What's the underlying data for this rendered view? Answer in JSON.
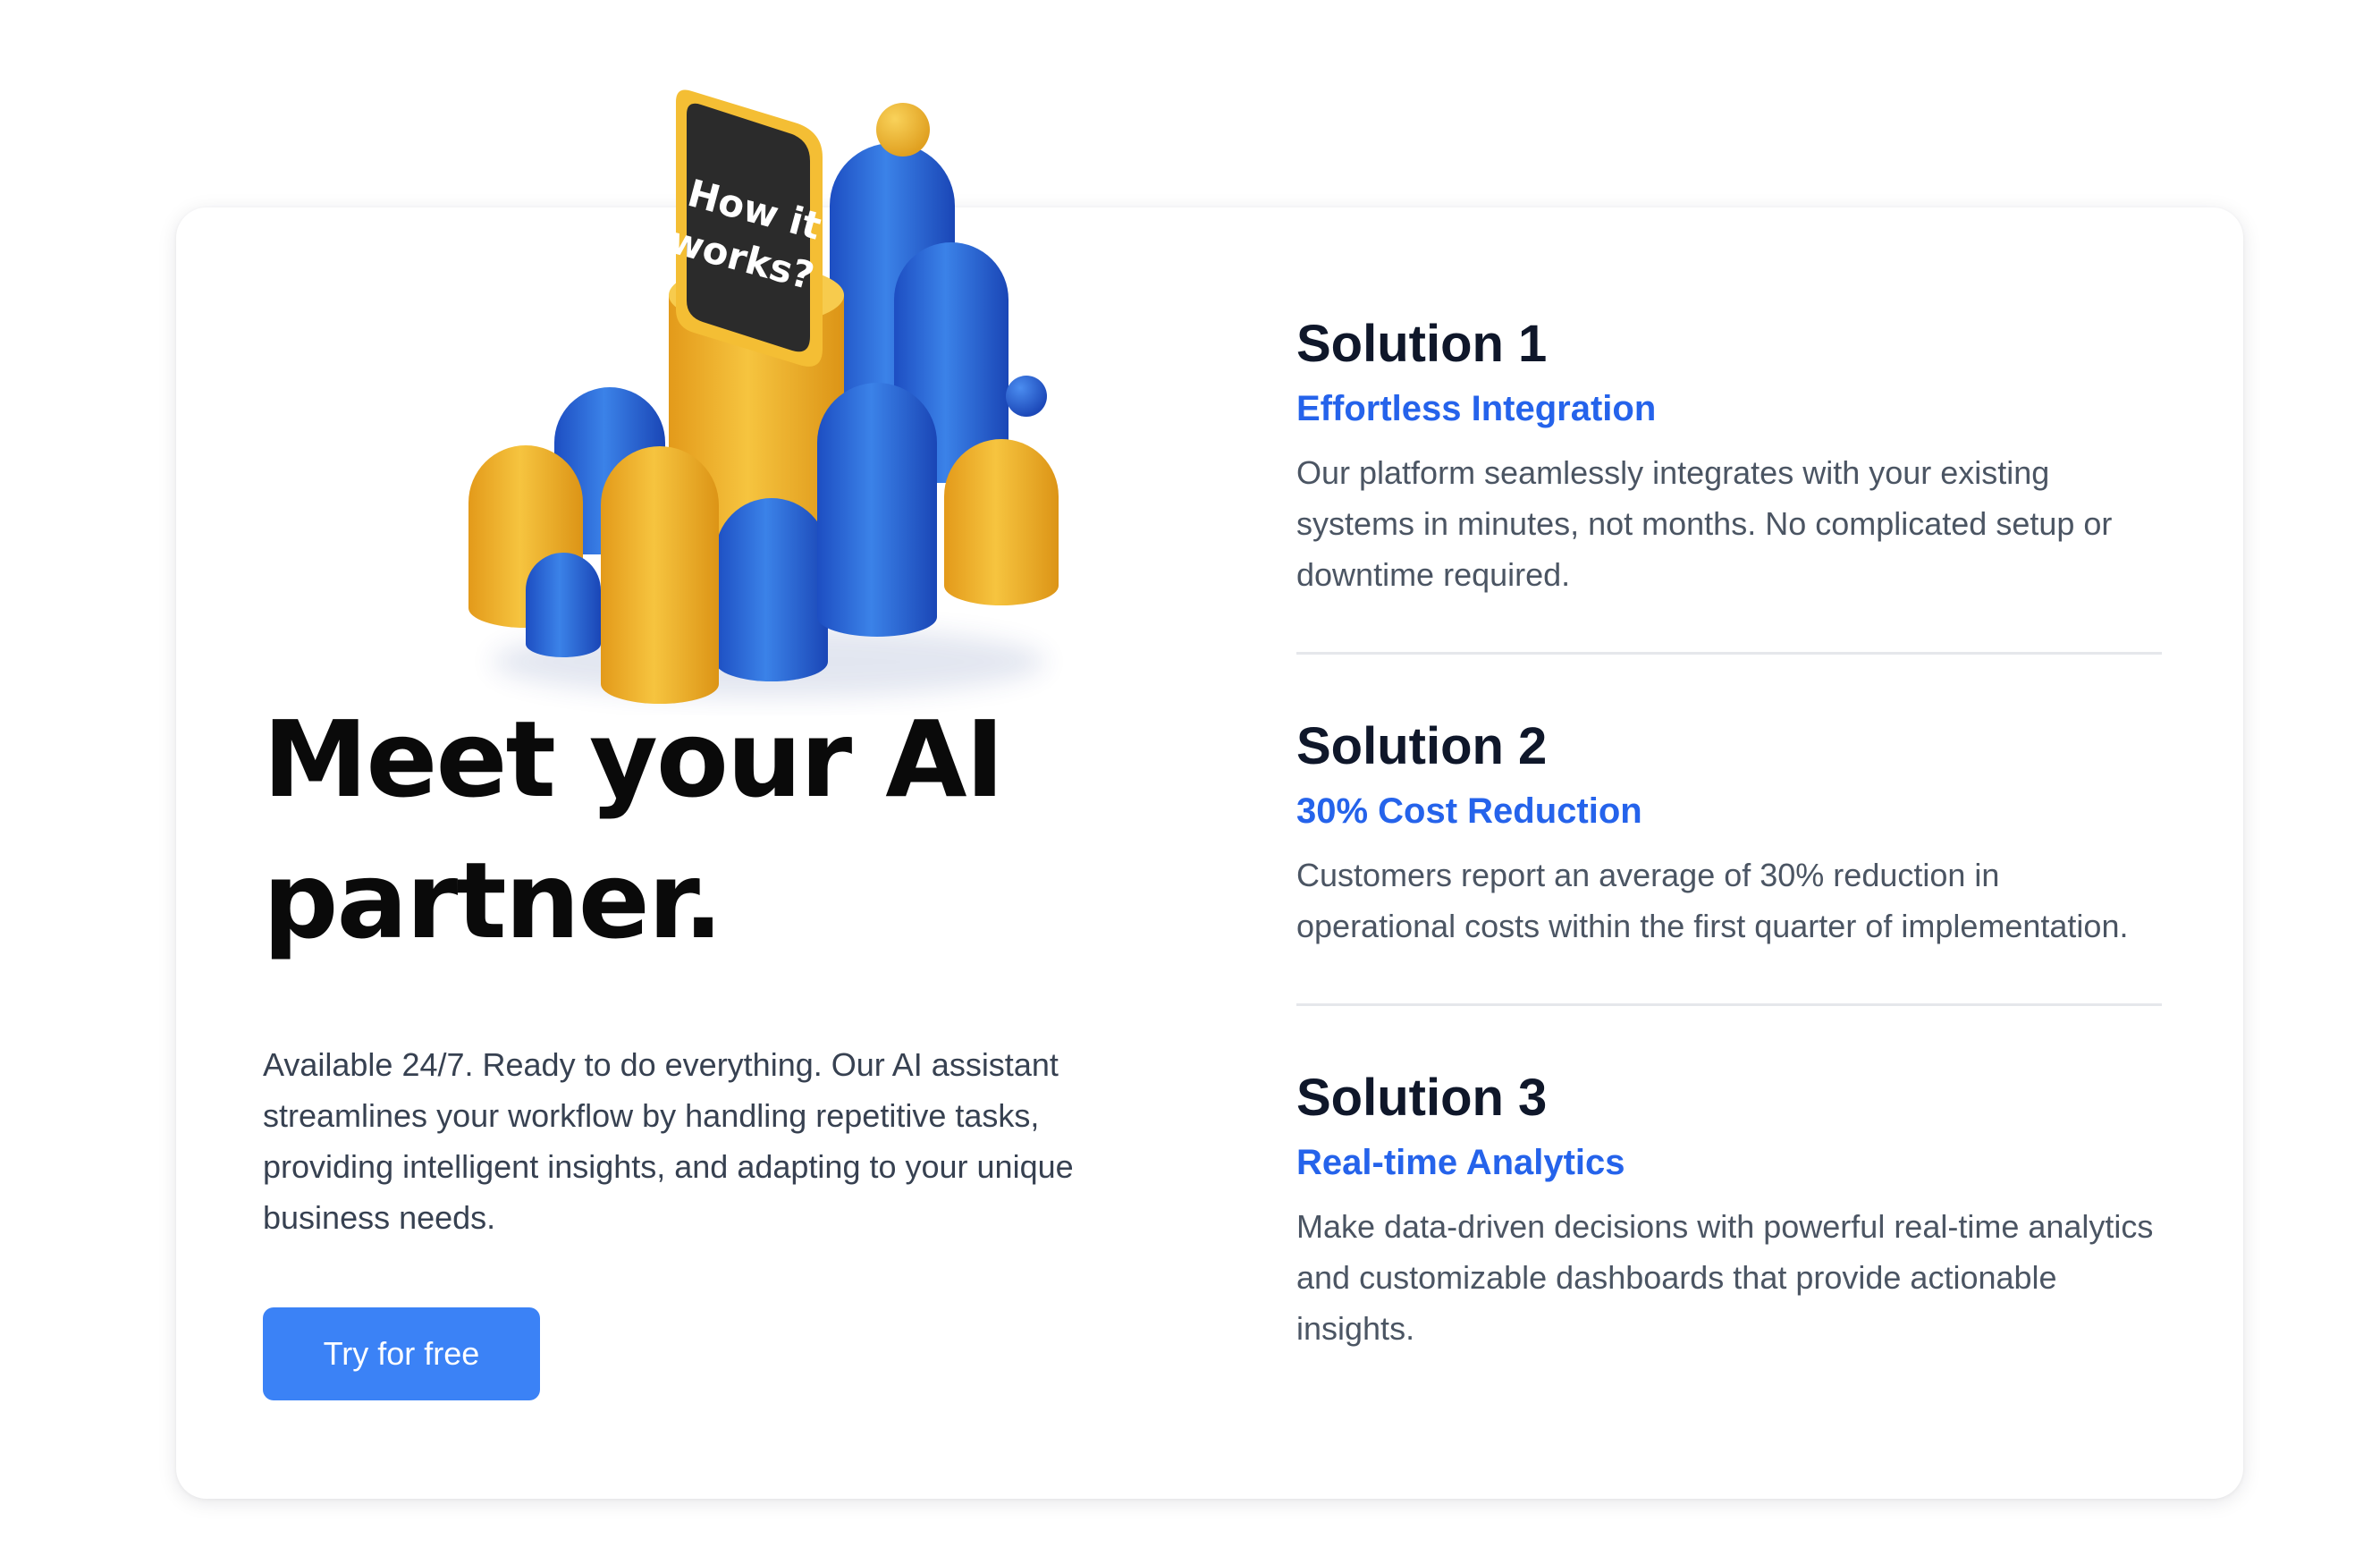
{
  "illustration": {
    "sign_line1": "How it",
    "sign_line2": "works?"
  },
  "hero": {
    "title": "Meet your AI\npartner.",
    "description": "Available 24/7. Ready to do everything. Our AI assistant streamlines your workflow by handling repetitive tasks, providing intelligent insights, and adapting to your unique business needs.",
    "cta_label": "Try for free"
  },
  "solutions": [
    {
      "title": "Solution 1",
      "subtitle": "Effortless Integration",
      "description": "Our platform seamlessly integrates with your existing systems in minutes, not months. No complicated setup or downtime required."
    },
    {
      "title": "Solution 2",
      "subtitle": "30% Cost Reduction",
      "description": "Customers report an average of 30% reduction in operational costs within the first quarter of implementation."
    },
    {
      "title": "Solution 3",
      "subtitle": "Real-time Analytics",
      "description": "Make data-driven decisions with powerful real-time analytics and customizable dashboards that provide actionable insights."
    }
  ],
  "colors": {
    "accent": "#2563eb",
    "button": "#3b82f6",
    "yellow": "#f3b62c",
    "blue": "#2f6be0",
    "heading": "#0f172a",
    "body_text": "#4b5563"
  }
}
